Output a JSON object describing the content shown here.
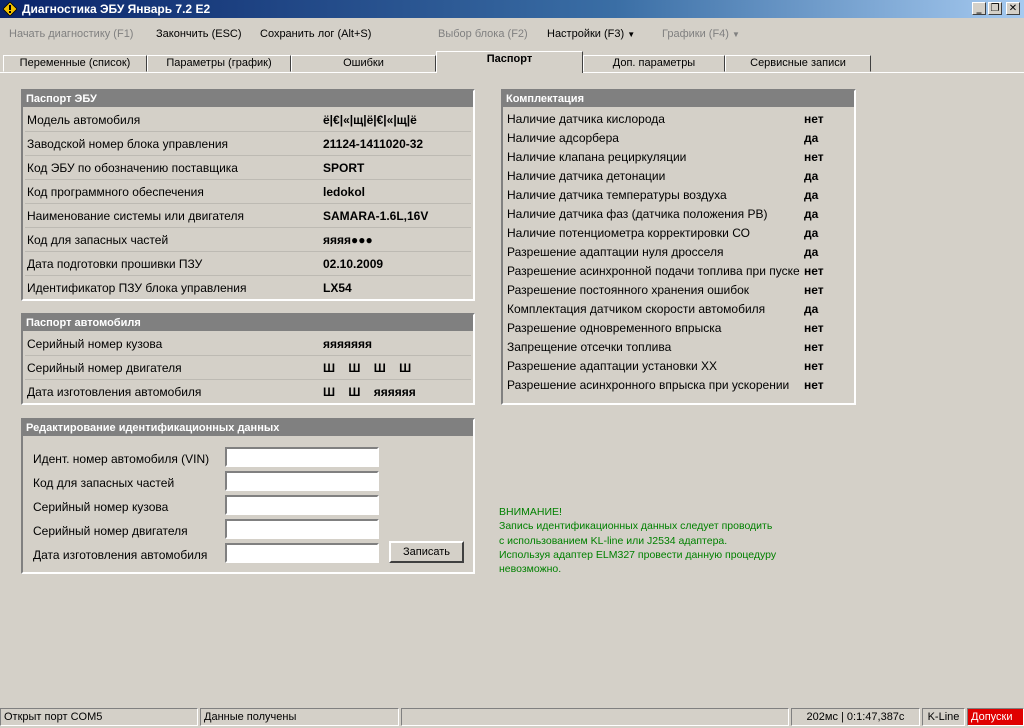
{
  "window": {
    "title": "Диагностика ЭБУ Январь 7.2 E2"
  },
  "menu": {
    "start": "Начать диагностику (F1)",
    "finish": "Закончить (ESC)",
    "save_log": "Сохранить лог (Alt+S)",
    "select_block": "Выбор блока (F2)",
    "settings": "Настройки (F3)",
    "graphs": "Графики (F4)"
  },
  "tabs": [
    "Переменные (список)",
    "Параметры (график)",
    "Ошибки",
    "Паспорт",
    "Доп. параметры",
    "Сервисные записи"
  ],
  "ecu_passport": {
    "title": "Паспорт ЭБУ",
    "rows": [
      {
        "label": "Модель автомобиля",
        "value": "ё|€|«|щ|ё|€|«|щ|ё"
      },
      {
        "label": "Заводской номер блока управления",
        "value": "21124-1411020-32"
      },
      {
        "label": "Код ЭБУ по обозначению поставщика",
        "value": "SPORT"
      },
      {
        "label": "Код программного обеспечения",
        "value": "ledokol"
      },
      {
        "label": "Наименование системы или двигателя",
        "value": "SAMARA-1.6L,16V"
      },
      {
        "label": "Код для запасных частей",
        "value": "яяяя●●●"
      },
      {
        "label": "Дата подготовки прошивки ПЗУ",
        "value": "02.10.2009"
      },
      {
        "label": "Идентификатор ПЗУ блока управления",
        "value": "LX54"
      }
    ]
  },
  "car_passport": {
    "title": "Паспорт автомобиля",
    "rows": [
      {
        "label": "Серийный номер кузова",
        "value": "яяяяяяя"
      },
      {
        "label": "Серийный номер двигателя",
        "value": "Ш Ш Ш Ш"
      },
      {
        "label": "Дата изготовления автомобиля",
        "value": "Ш Ш яяяяяя"
      }
    ]
  },
  "edit_ident": {
    "title": "Редактирование идентификационных данных",
    "fields": [
      {
        "label": "Идент. номер автомобиля (VIN)",
        "value": ""
      },
      {
        "label": "Код для запасных частей",
        "value": ""
      },
      {
        "label": "Серийный номер кузова",
        "value": ""
      },
      {
        "label": "Серийный номер двигателя",
        "value": ""
      },
      {
        "label": "Дата изготовления автомобиля",
        "value": ""
      }
    ],
    "write_button": "Записать"
  },
  "equipment": {
    "title": "Комплектация",
    "rows": [
      {
        "label": "Наличие датчика кислорода",
        "value": "нет"
      },
      {
        "label": "Наличие адсорбера",
        "value": "да"
      },
      {
        "label": "Наличие клапана рециркуляции",
        "value": "нет"
      },
      {
        "label": "Наличие датчика детонации",
        "value": "да"
      },
      {
        "label": "Наличие датчика температуры воздуха",
        "value": "да"
      },
      {
        "label": "Наличие датчика фаз (датчика положения РВ)",
        "value": "да"
      },
      {
        "label": "Наличие потенциометра корректировки СО",
        "value": "да"
      },
      {
        "label": "Разрешение адаптации нуля дросселя",
        "value": "да"
      },
      {
        "label": "Разрешение асинхронной подачи топлива при пуске",
        "value": "нет"
      },
      {
        "label": "Разрешение постоянного хранения ошибок",
        "value": "нет"
      },
      {
        "label": "Комплектация датчиком скорости автомобиля",
        "value": "да"
      },
      {
        "label": "Разрешение одновременного впрыска",
        "value": "нет"
      },
      {
        "label": "Запрещение отсечки топлива",
        "value": "нет"
      },
      {
        "label": "Разрешение адаптации установки ХХ",
        "value": "нет"
      },
      {
        "label": "Разрешение асинхронного впрыска при ускорении",
        "value": "нет"
      }
    ]
  },
  "warning": {
    "lines": [
      "ВНИМАНИЕ!",
      "Запись идентификационных данных следует проводить",
      "с использованием KL-line или J2534 адаптера.",
      "Используя адаптер ELM327 провести данную процедуру",
      "невозможно."
    ],
    "color": "#008000"
  },
  "status": {
    "port": "Открыт порт COM5",
    "data": "Данные получены",
    "timing": "202мс | 0:1:47,387с",
    "protocol": "K-Line",
    "tolerances": "Допуски",
    "tolerances_color": "#e00000"
  }
}
